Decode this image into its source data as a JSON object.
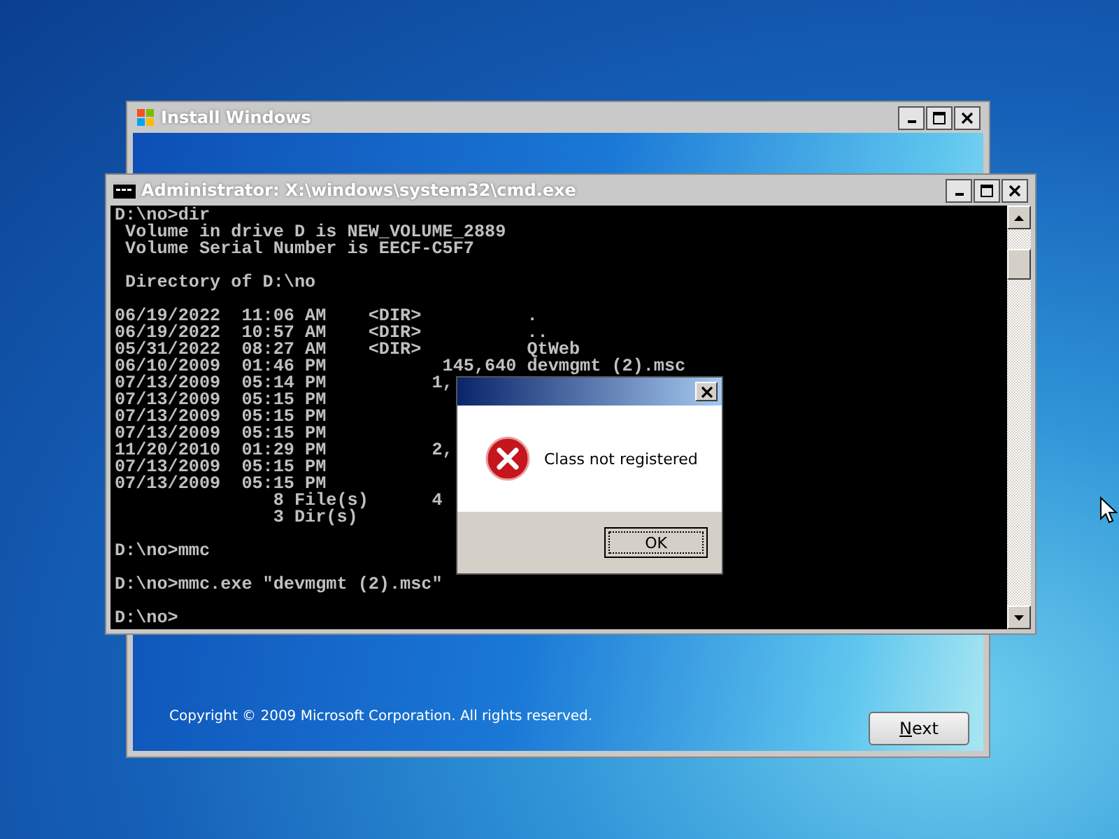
{
  "setup_window": {
    "title": "Install Windows",
    "copyright": "Copyright © 2009 Microsoft Corporation. All rights reserved.",
    "next_button": "Next"
  },
  "console_window": {
    "title": "Administrator: X:\\windows\\system32\\cmd.exe",
    "lines": [
      {
        "text": "D:\\no>dir",
        "space_before": false
      },
      {
        "text": " Volume in drive D is NEW_VOLUME_2889",
        "space_before": false
      },
      {
        "text": " Volume Serial Number is EECF-C5F7",
        "space_before": false
      },
      {
        "text": " Directory of D:\\no",
        "space_before": true
      },
      {
        "text": "06/19/2022  11:06 AM    <DIR>          .",
        "space_before": true
      },
      {
        "text": "06/19/2022  10:57 AM    <DIR>          ..",
        "space_before": false
      },
      {
        "text": "05/31/2022  08:27 AM    <DIR>          QtWeb",
        "space_before": false
      },
      {
        "text": "06/10/2009  01:46 PM           145,640 devmgmt (2).msc",
        "space_before": false
      },
      {
        "text": "07/13/2009  05:14 PM          1,",
        "space_before": false
      },
      {
        "text": "07/13/2009  05:15 PM",
        "space_before": false
      },
      {
        "text": "07/13/2009  05:15 PM",
        "space_before": false
      },
      {
        "text": "07/13/2009  05:15 PM",
        "space_before": false
      },
      {
        "text": "11/20/2010  01:29 PM          2,",
        "space_before": false
      },
      {
        "text": "07/13/2009  05:15 PM",
        "space_before": false
      },
      {
        "text": "07/13/2009  05:15 PM",
        "space_before": false
      },
      {
        "text": "               8 File(s)      4",
        "space_before": false
      },
      {
        "text": "               3 Dir(s)",
        "space_before": false
      },
      {
        "text": "D:\\no>mmc",
        "space_before": true
      },
      {
        "text": "D:\\no>mmc.exe \"devmgmt (2).msc\"",
        "space_before": true
      },
      {
        "text": "D:\\no>",
        "space_before": true
      }
    ]
  },
  "dialog": {
    "message": "Class not registered",
    "ok_button": "OK"
  }
}
